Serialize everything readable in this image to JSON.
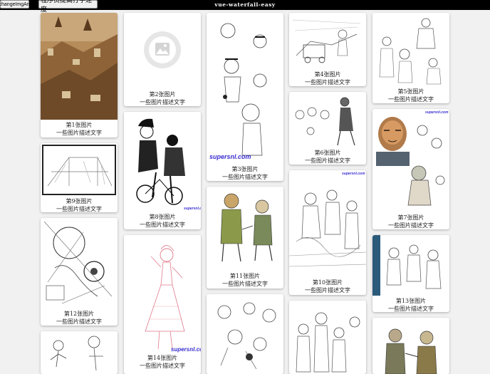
{
  "topbar": {
    "change_button_label": "changeImgArr",
    "speed_button_label": "程序员提高打字速度",
    "title": "vue-waterfall-easy"
  },
  "watermark": "supersnl.com",
  "cards": [
    {
      "title": "第1张图片",
      "desc": "一些图片描述文字",
      "image": "aerial-city-painting"
    },
    {
      "title": "第2张图片",
      "desc": "一些图片描述文字",
      "image": "placeholder-image-icon"
    },
    {
      "title": "第3张图片",
      "desc": "一些图片描述文字",
      "image": "sketch-faces"
    },
    {
      "title": "第4张图片",
      "desc": "一些图片描述文字",
      "image": "sketch-street"
    },
    {
      "title": "第5张图片",
      "desc": "一些图片描述文字",
      "image": "sketch-figures"
    },
    {
      "title": "第6张图片",
      "desc": "一些图片描述文字",
      "image": "sketch-heads"
    },
    {
      "title": "第7张图片",
      "desc": "一些图片描述文字",
      "image": "painted-character"
    },
    {
      "title": "第8张图片",
      "desc": "一些图片描述文字",
      "image": "ink-bicycle-couple"
    },
    {
      "title": "第9张图片",
      "desc": "一些图片描述文字",
      "image": "sketch-interior"
    },
    {
      "title": "第10张图片",
      "desc": "一些图片描述文字",
      "image": "sketch-crowd"
    },
    {
      "title": "第11张图片",
      "desc": "一些图片描述文字",
      "image": "colored-animal-warriors"
    },
    {
      "title": "第12张图片",
      "desc": "一些图片描述文字",
      "image": "sketch-mechanical"
    },
    {
      "title": "第13张图片",
      "desc": "一些图片描述文字",
      "image": "sketch-characters"
    },
    {
      "title": "第14张图片",
      "desc": "一些图片描述文字",
      "image": "red-line-woman"
    },
    {
      "title": "",
      "desc": "",
      "image": "sketch-figures"
    },
    {
      "title": "",
      "desc": "",
      "image": "sketch-cartoon-animals"
    },
    {
      "title": "",
      "desc": "",
      "image": "sketch-crowd"
    },
    {
      "title": "",
      "desc": "",
      "image": "colored-animal-warriors"
    }
  ]
}
